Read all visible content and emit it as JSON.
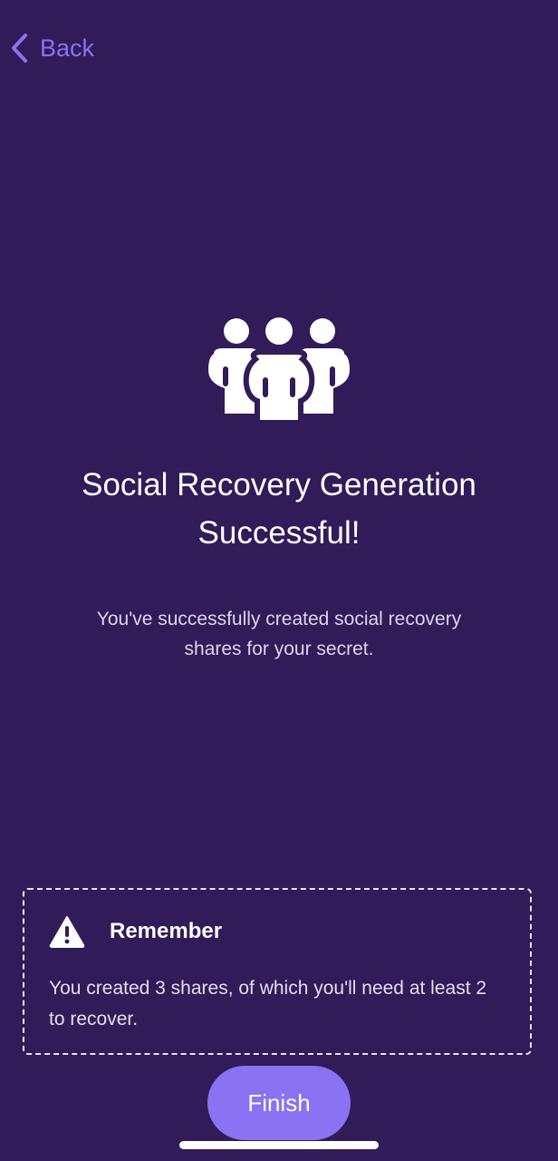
{
  "nav": {
    "back_label": "Back",
    "back_icon": "chevron-left-icon"
  },
  "hero": {
    "icon": "group-people-icon",
    "title_line1": "Social Recovery Generation",
    "title_line2": "Successful!",
    "subtitle_line1": "You've successfully created social recovery",
    "subtitle_line2": "shares for your secret."
  },
  "notice": {
    "icon": "warning-icon",
    "title": "Remember",
    "body": "You created 3 shares, of which you'll need at least 2 to recover."
  },
  "actions": {
    "finish_label": "Finish"
  },
  "colors": {
    "background": "#311b58",
    "accent": "#8a72f2"
  }
}
